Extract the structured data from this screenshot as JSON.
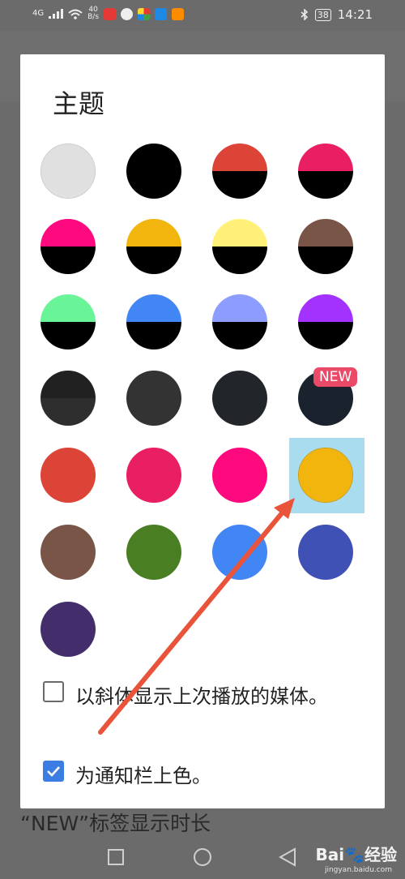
{
  "status_bar": {
    "signal": "4G",
    "speed_value": "40",
    "speed_unit": "B/s",
    "battery": "38",
    "time": "14:21"
  },
  "dialog": {
    "title": "主题",
    "new_badge": "NEW",
    "swatches": [
      {
        "top": "#e0e0e0",
        "bottom": "#e0e0e0"
      },
      {
        "top": "#000000",
        "bottom": "#000000"
      },
      {
        "top": "#db4437",
        "bottom": "#000000"
      },
      {
        "top": "#e91e63",
        "bottom": "#000000"
      },
      {
        "top": "#ff0a7e",
        "bottom": "#000000"
      },
      {
        "top": "#f2b50d",
        "bottom": "#000000"
      },
      {
        "top": "#fff178",
        "bottom": "#000000"
      },
      {
        "top": "#795548",
        "bottom": "#000000"
      },
      {
        "top": "#69f497",
        "bottom": "#000000"
      },
      {
        "top": "#4285f4",
        "bottom": "#000000"
      },
      {
        "top": "#8c9cff",
        "bottom": "#000000"
      },
      {
        "top": "#a332ff",
        "bottom": "#000000"
      },
      {
        "top": "#212121",
        "bottom": "#2e2e2e"
      },
      {
        "top": "#333333",
        "bottom": "#333333"
      },
      {
        "top": "#22262b",
        "bottom": "#22262b"
      },
      {
        "top": "#1a222e",
        "bottom": "#1a222e"
      },
      {
        "top": "#db4437",
        "bottom": "#db4437"
      },
      {
        "top": "#e91e63",
        "bottom": "#e91e63"
      },
      {
        "top": "#ff0a7e",
        "bottom": "#ff0a7e"
      },
      {
        "top": "#f2b50d",
        "bottom": "#f2b50d"
      },
      {
        "top": "#795548",
        "bottom": "#795548"
      },
      {
        "top": "#4a7e23",
        "bottom": "#4a7e23"
      },
      {
        "top": "#4285f4",
        "bottom": "#4285f4"
      },
      {
        "top": "#3f51b5",
        "bottom": "#3f51b5"
      },
      {
        "top": "#432d6b",
        "bottom": "#432d6b"
      }
    ],
    "options": [
      {
        "label": "以斜体显示上次播放的媒体。",
        "checked": false
      },
      {
        "label": "为通知栏上色。",
        "checked": true
      }
    ]
  },
  "background_label": "“NEW”标签显示时长",
  "watermark": {
    "brand": "Bai",
    "brand_suffix": "经验",
    "url": "jingyan.baidu.com"
  }
}
